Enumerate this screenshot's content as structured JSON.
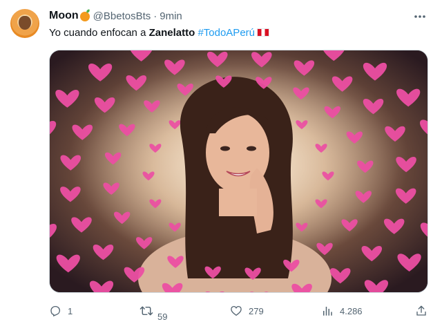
{
  "user": {
    "display_name": "Moon",
    "handle": "@BbetosBts",
    "separator": "·",
    "time": "9min"
  },
  "tweet": {
    "text_before": "Yo cuando enfocan a ",
    "bold_name": "Zanelatto",
    "hashtag": "#TodoAPerú"
  },
  "icons": {
    "more": "more-horizontal-icon",
    "reply": "reply-icon",
    "retweet": "retweet-icon",
    "like": "heart-icon",
    "views": "views-bar-chart-icon",
    "share": "share-icon"
  },
  "actions": {
    "reply_count": "1",
    "retweet_count": "59",
    "like_count": "279",
    "view_count": "4.286"
  },
  "colors": {
    "link": "#1d9bf0",
    "muted": "#536471",
    "text": "#0f1419",
    "heart_pink": "#e8479b"
  }
}
